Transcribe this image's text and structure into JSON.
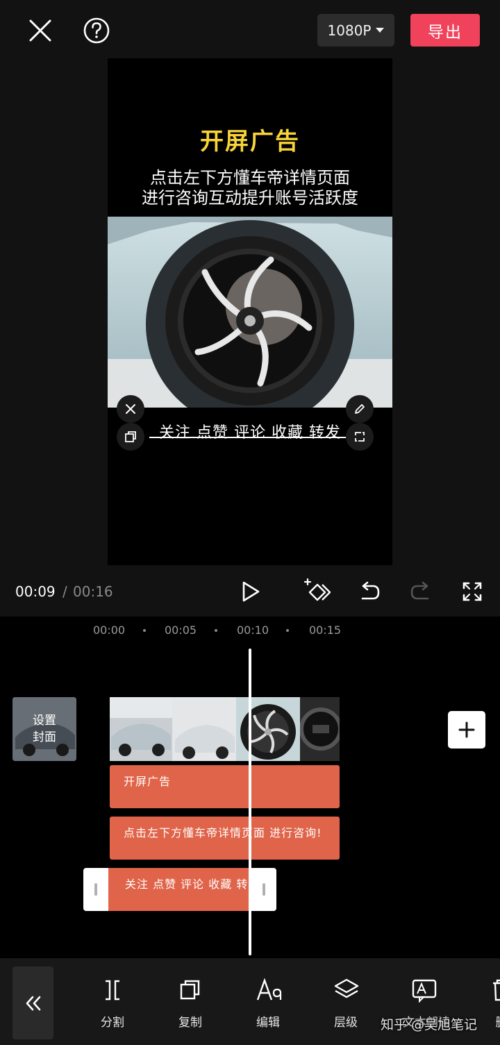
{
  "header": {
    "resolution": "1080P",
    "export_label": "导出"
  },
  "preview": {
    "ad_title": "开屏广告",
    "ad_desc_lines": [
      "点击左下方懂车帝详情页面",
      "进行咨询互动提升账号活跃度"
    ],
    "caption": "关注 点赞 评论 收藏 转发"
  },
  "playback": {
    "current_time": "00:09",
    "separator": "/",
    "total_time": "00:16"
  },
  "timeline": {
    "ruler": [
      "00:00",
      "00:05",
      "00:10",
      "00:15"
    ],
    "cover_lines": [
      "设置",
      "封面"
    ],
    "tracks": [
      "开屏广告",
      "点击左下方懂车帝详情页面 进行咨询!",
      "关注 点赞 评论 收藏 转"
    ]
  },
  "toolbar": {
    "tools": [
      {
        "label": "分割",
        "icon": "split-icon"
      },
      {
        "label": "复制",
        "icon": "copy-icon"
      },
      {
        "label": "编辑",
        "icon": "text-style-icon"
      },
      {
        "label": "层级",
        "icon": "layers-icon"
      },
      {
        "label": "文本朗读",
        "icon": "text-to-speech-icon"
      },
      {
        "label": "删",
        "icon": "delete-icon"
      }
    ],
    "watermark": "知乎 @吴旭笔记"
  },
  "colors": {
    "accent": "#f0425b",
    "ad_title": "#f7d438",
    "track": "#e0644a",
    "background": "#121212"
  }
}
